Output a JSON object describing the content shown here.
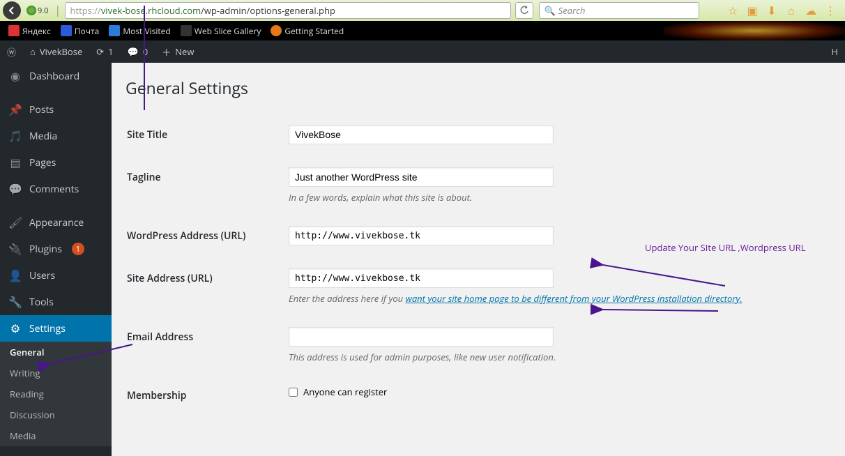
{
  "browser": {
    "load_time": "9.0",
    "url_protocol": "https://",
    "url_host": "vivek-bose.rhcloud.com",
    "url_path": "/wp-admin/options-general.php",
    "search_placeholder": "Search",
    "bookmarks": [
      {
        "label": "Яндекс",
        "icon": "y"
      },
      {
        "label": "Почта",
        "icon": "m"
      },
      {
        "label": "Most Visited",
        "icon": "v"
      },
      {
        "label": "Web Slice Gallery",
        "icon": "w"
      },
      {
        "label": "Getting Started",
        "icon": "f"
      }
    ]
  },
  "adminbar": {
    "site_name": "VivekBose",
    "updates_count": "1",
    "comments_count": "0",
    "new_label": "New",
    "howdy": "H"
  },
  "menu": {
    "dashboard": "Dashboard",
    "posts": "Posts",
    "media": "Media",
    "pages": "Pages",
    "comments": "Comments",
    "appearance": "Appearance",
    "plugins": "Plugins",
    "plugins_count": "1",
    "users": "Users",
    "tools": "Tools",
    "settings": "Settings",
    "sub": {
      "general": "General",
      "writing": "Writing",
      "reading": "Reading",
      "discussion": "Discussion",
      "media": "Media"
    }
  },
  "page": {
    "title": "General Settings",
    "fields": {
      "site_title_label": "Site Title",
      "site_title_value": "VivekBose",
      "tagline_label": "Tagline",
      "tagline_value": "Just another WordPress site",
      "tagline_desc": "In a few words, explain what this site is about.",
      "wp_url_label": "WordPress Address (URL)",
      "wp_url_value": "http://www.vivekbose.tk",
      "site_url_label": "Site Address (URL)",
      "site_url_value": "http://www.vivekbose.tk",
      "site_url_desc_prefix": "Enter the address here if you ",
      "site_url_desc_link": "want your site home page to be different from your WordPress installation directory.",
      "email_label": "Email Address",
      "email_value": "",
      "email_desc": "This address is used for admin purposes, like new user notification.",
      "membership_label": "Membership",
      "membership_checkbox": "Anyone can register"
    }
  },
  "annotation": {
    "text": "Update Your SIte URL ,Wordpress URL"
  }
}
